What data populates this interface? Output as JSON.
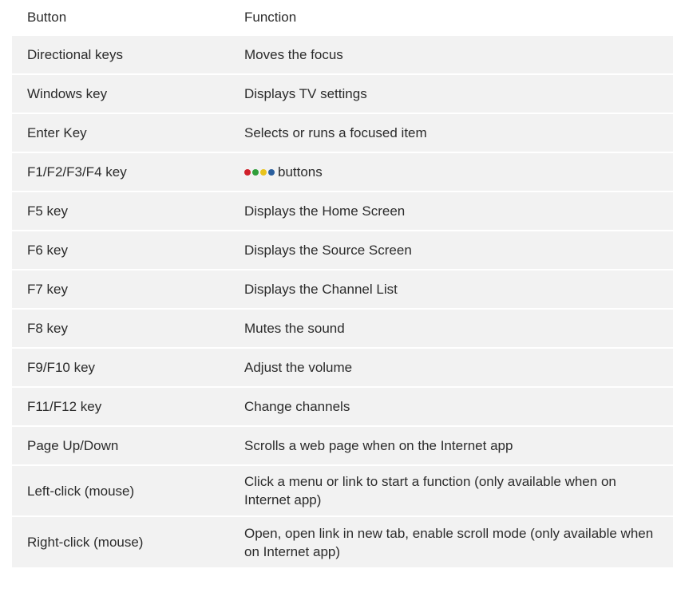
{
  "header": {
    "button": "Button",
    "function": "Function"
  },
  "rows": [
    {
      "button": "Directional keys",
      "function": "Moves the focus"
    },
    {
      "button": "Windows key",
      "function": "Displays TV settings"
    },
    {
      "button": "Enter Key",
      "function": "Selects or runs a focused item"
    },
    {
      "button": "F1/F2/F3/F4 key",
      "function": "buttons"
    },
    {
      "button": "F5 key",
      "function": "Displays the Home Screen"
    },
    {
      "button": "F6 key",
      "function": "Displays the Source Screen"
    },
    {
      "button": "F7 key",
      "function": "Displays the Channel List"
    },
    {
      "button": "F8 key",
      "function": "Mutes the sound"
    },
    {
      "button": "F9/F10 key",
      "function": "Adjust the volume"
    },
    {
      "button": "F11/F12 key",
      "function": "Change channels"
    },
    {
      "button": "Page Up/Down",
      "function": "Scrolls a web page when on the Internet app"
    },
    {
      "button": "Left-click (mouse)",
      "function": "Click a menu or link to start a function (only available when on Internet app)"
    },
    {
      "button": "Right-click (mouse)",
      "function": "Open, open link in new tab, enable scroll mode (only available when on Internet app)"
    }
  ],
  "color_dots": [
    "#d0202a",
    "#2f9e3a",
    "#e8c31c",
    "#2a5f9e"
  ]
}
